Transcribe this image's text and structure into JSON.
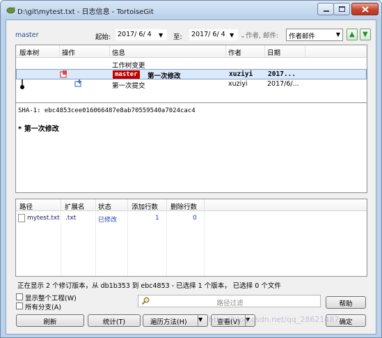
{
  "window": {
    "title": "D:\\git\\mytest.txt - 日志信息 - TortoiseGit"
  },
  "filter": {
    "branch": "master",
    "from_label": "起始:",
    "from_date": "2017/ 6/ 4",
    "to_label": "至:",
    "to_date": "2017/ 6/ 4",
    "search_label": "作者, 邮件:",
    "search_field": "作者邮件"
  },
  "log": {
    "columns": [
      "版本树",
      "操作",
      "信息",
      "作者",
      "日期"
    ],
    "rows": [
      {
        "message": "工作树变更",
        "author": "",
        "date": ""
      },
      {
        "tag": "master",
        "message": "第一次修改",
        "author": "xuziyi",
        "date": "2017..."
      },
      {
        "message": "第一次提交",
        "author": "xuziyi",
        "date": "2017/6/..."
      }
    ]
  },
  "detail": {
    "sha": "SHA-1: ebc4853cee016066487e8ab70559540a7024cac4",
    "message": "* 第一次修改"
  },
  "files": {
    "columns": [
      "路径",
      "扩展名",
      "状态",
      "添加行数",
      "删除行数"
    ],
    "rows": [
      {
        "path": "mytest.txt",
        "ext": ".txt",
        "status": "已修改",
        "added": "1",
        "deleted": "0"
      }
    ]
  },
  "status_text": "正在显示 2 个修订版本，从 db1b353 到 ebc4853 - 已选择 1 个版本， 已选择 0 个文件",
  "options": {
    "whole_project": "显示整个工程(W)",
    "all_branches": "所有分支(A)"
  },
  "path_filter_placeholder": "路径过滤",
  "buttons": {
    "refresh": "刷新",
    "stats": "统计(T)",
    "walk": "遍历方法(H)",
    "view": "查看(V)",
    "help": "帮助",
    "ok": "确定"
  },
  "watermark": "http://blog.csdn.net/qq_28621487",
  "colors": {
    "master_tag": "#c00000",
    "selected_row": "#dbe9fb"
  }
}
